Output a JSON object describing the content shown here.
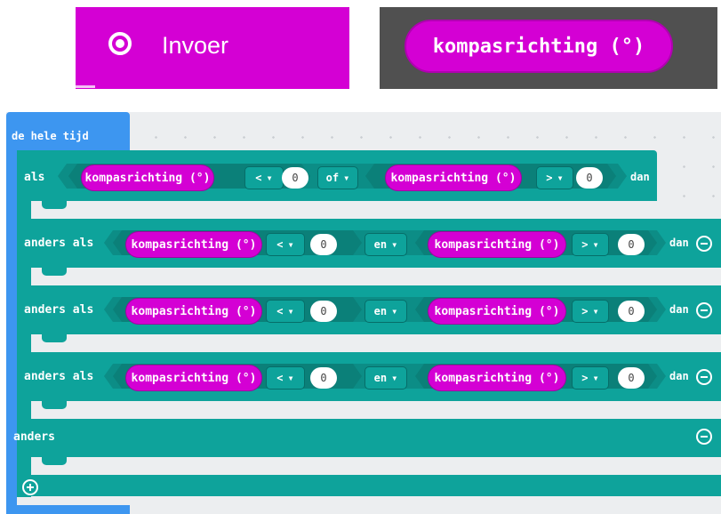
{
  "category": {
    "label": "Invoer",
    "icon": "radio-target-icon"
  },
  "preview_block": {
    "label": "kompasrichting (°)"
  },
  "event": {
    "label": "de hele tijd"
  },
  "if_block": {
    "if_label": "als",
    "then_label": "dan",
    "else_if_label": "anders als",
    "else_label": "anders",
    "sensor_label": "kompasrichting (°)",
    "rows": [
      {
        "op1": "<",
        "val1": "0",
        "logic": "of",
        "op2": ">",
        "val2": "0"
      },
      {
        "op1": "<",
        "val1": "0",
        "logic": "en",
        "op2": ">",
        "val2": "0"
      },
      {
        "op1": "<",
        "val1": "0",
        "logic": "en",
        "op2": ">",
        "val2": "0"
      },
      {
        "op1": "<",
        "val1": "0",
        "logic": "en",
        "op2": ">",
        "val2": "0"
      }
    ]
  },
  "colors": {
    "input": "#d400d4",
    "logic": "#0ea39b",
    "basic": "#3d96f0",
    "preview_bg": "#505050",
    "workspace": "#eceef0"
  }
}
